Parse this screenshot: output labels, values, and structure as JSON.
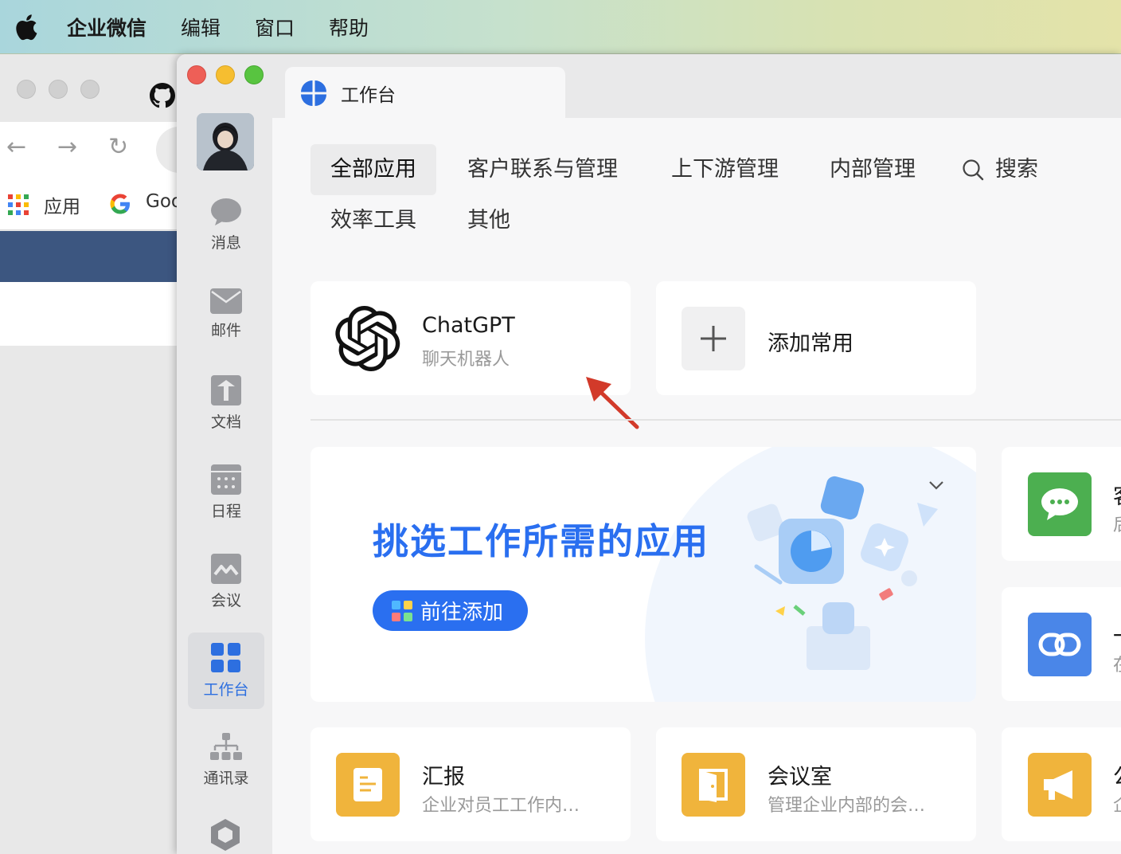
{
  "menubar": {
    "app_name": "企业微信",
    "items": [
      "编辑",
      "窗口",
      "帮助"
    ]
  },
  "browser": {
    "bookmark_apps": "应用",
    "bookmark_google": "Goo"
  },
  "sidebar": {
    "items": [
      {
        "label": "消息",
        "icon": "chat-bubble-icon"
      },
      {
        "label": "邮件",
        "icon": "mail-icon"
      },
      {
        "label": "文档",
        "icon": "document-icon"
      },
      {
        "label": "日程",
        "icon": "calendar-icon"
      },
      {
        "label": "会议",
        "icon": "meeting-icon"
      },
      {
        "label": "工作台",
        "icon": "workbench-icon",
        "active": true
      },
      {
        "label": "通讯录",
        "icon": "contacts-icon"
      }
    ]
  },
  "tab": {
    "title": "工作台"
  },
  "categories": {
    "all": "全部应用",
    "customer": "客户联系与管理",
    "updown": "上下游管理",
    "internal": "内部管理",
    "search": "搜索",
    "efficiency": "效率工具",
    "other": "其他"
  },
  "favorites": [
    {
      "title": "ChatGPT",
      "subtitle": "聊天机器人",
      "icon": "openai-logo-icon"
    },
    {
      "title": "添加常用",
      "icon": "plus-icon"
    }
  ],
  "promo": {
    "title": "挑选工作所需的应用",
    "button": "前往添加"
  },
  "right_cards": [
    {
      "title": "客",
      "subtitle": "后",
      "color": "#4caf50",
      "icon": "wechat-chat-icon"
    },
    {
      "title": "一",
      "subtitle": "在",
      "color": "#4a86e8",
      "icon": "link-icon"
    }
  ],
  "bottom_apps": [
    {
      "title": "汇报",
      "subtitle": "企业对员工工作内…",
      "color": "#f0b43c",
      "icon": "report-icon"
    },
    {
      "title": "会议室",
      "subtitle": "管理企业内部的会…",
      "color": "#f0b43c",
      "icon": "door-icon"
    },
    {
      "title": "公",
      "subtitle": "企",
      "color": "#f0b43c",
      "icon": "megaphone-icon"
    }
  ],
  "colors": {
    "accent": "#2a6ff0",
    "arrow": "#d23a2a"
  }
}
